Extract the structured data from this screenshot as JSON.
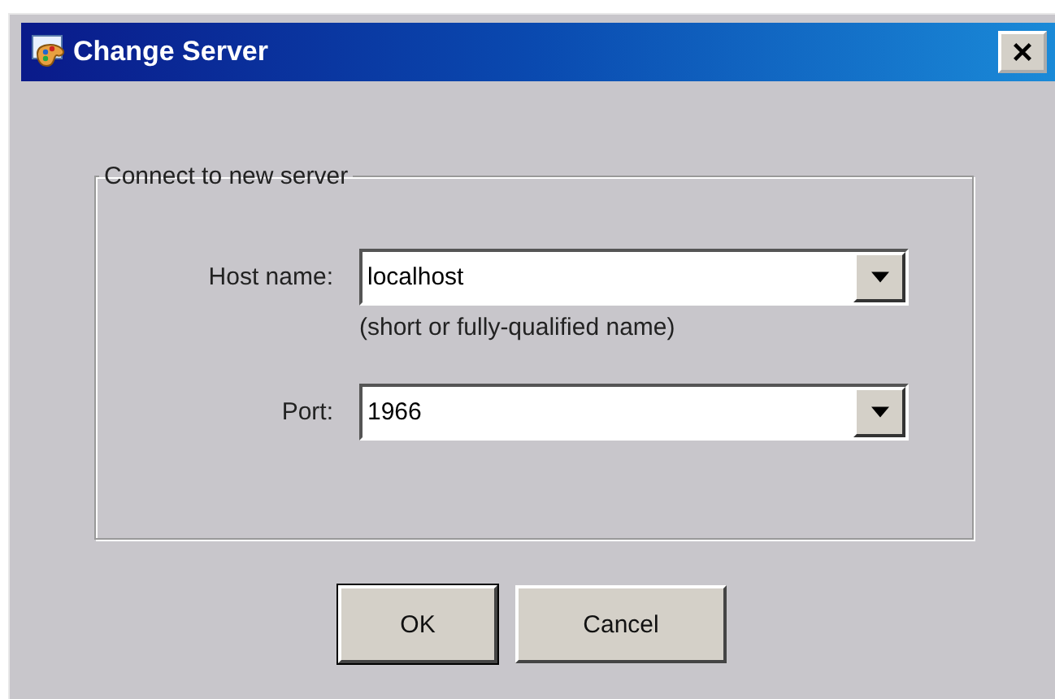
{
  "window": {
    "title": "Change Server"
  },
  "group": {
    "title": "Connect to new server",
    "fields": [
      {
        "label": "Host name:",
        "value": "localhost",
        "hint": "(short or fully-qualified name)"
      },
      {
        "label": "Port:",
        "value": "1966"
      }
    ]
  },
  "buttons": [
    {
      "label": "OK",
      "default": true
    },
    {
      "label": "Cancel",
      "default": false
    }
  ]
}
